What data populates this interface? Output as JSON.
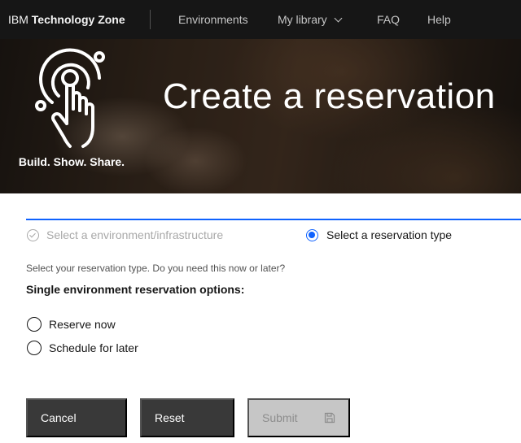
{
  "header": {
    "brand_prefix": "IBM",
    "brand_name": "Technology Zone",
    "nav": [
      {
        "label": "Environments"
      },
      {
        "label": "My library",
        "icon": "chevron-down-icon"
      },
      {
        "label": "FAQ"
      },
      {
        "label": "Help"
      }
    ]
  },
  "hero": {
    "tagline": "Build. Show. Share.",
    "title": "Create a reservation",
    "logo_icon": "touch-hand-icon"
  },
  "progress": {
    "steps": [
      {
        "label": "Select a environment/infrastructure",
        "state": "complete",
        "icon": "checkmark-outline-icon"
      },
      {
        "label": "Select a reservation type",
        "state": "current",
        "icon": "radio-selected-icon"
      }
    ]
  },
  "form": {
    "helper_text": "Select your reservation type. Do you need this now or later?",
    "legend": "Single environment reservation options:",
    "options": [
      {
        "label": "Reserve now",
        "selected": false
      },
      {
        "label": "Schedule for later",
        "selected": false
      }
    ]
  },
  "actions": {
    "cancel_label": "Cancel",
    "reset_label": "Reset",
    "submit_label": "Submit",
    "submit_icon": "save-icon",
    "submit_disabled": true
  },
  "colors": {
    "header_bg": "#161616",
    "accent": "#0f62fe",
    "button_dark": "#393939",
    "button_disabled": "#c6c6c6"
  }
}
